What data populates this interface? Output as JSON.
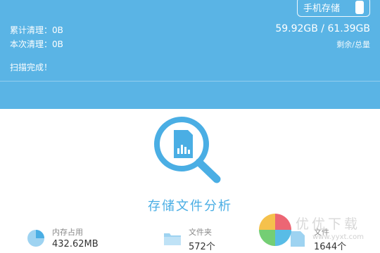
{
  "header": {
    "storage_button_label": "手机存储",
    "cumulative_clean": "累计清理：0B",
    "this_clean": "本次清理：0B",
    "storage_size": "59.92GB / 61.39GB",
    "storage_caption": "剩余/总量",
    "scan_status": "扫描完成！"
  },
  "main": {
    "title": "存储文件分析"
  },
  "stats": {
    "memory": {
      "label": "内存占用",
      "value": "432.62MB"
    },
    "folders": {
      "label": "文件夹",
      "value": "572个"
    },
    "files": {
      "label": "文件",
      "value": "1644个"
    }
  },
  "watermark": {
    "text": "优优下载",
    "sub": "www.yyxt.com"
  },
  "colors": {
    "header_bg": "#5ab4e5",
    "accent": "#4aaee4"
  },
  "icons": [
    "phone-icon",
    "sd-card-search-icon",
    "pie-chart-icon",
    "folder-icon",
    "file-icon"
  ]
}
